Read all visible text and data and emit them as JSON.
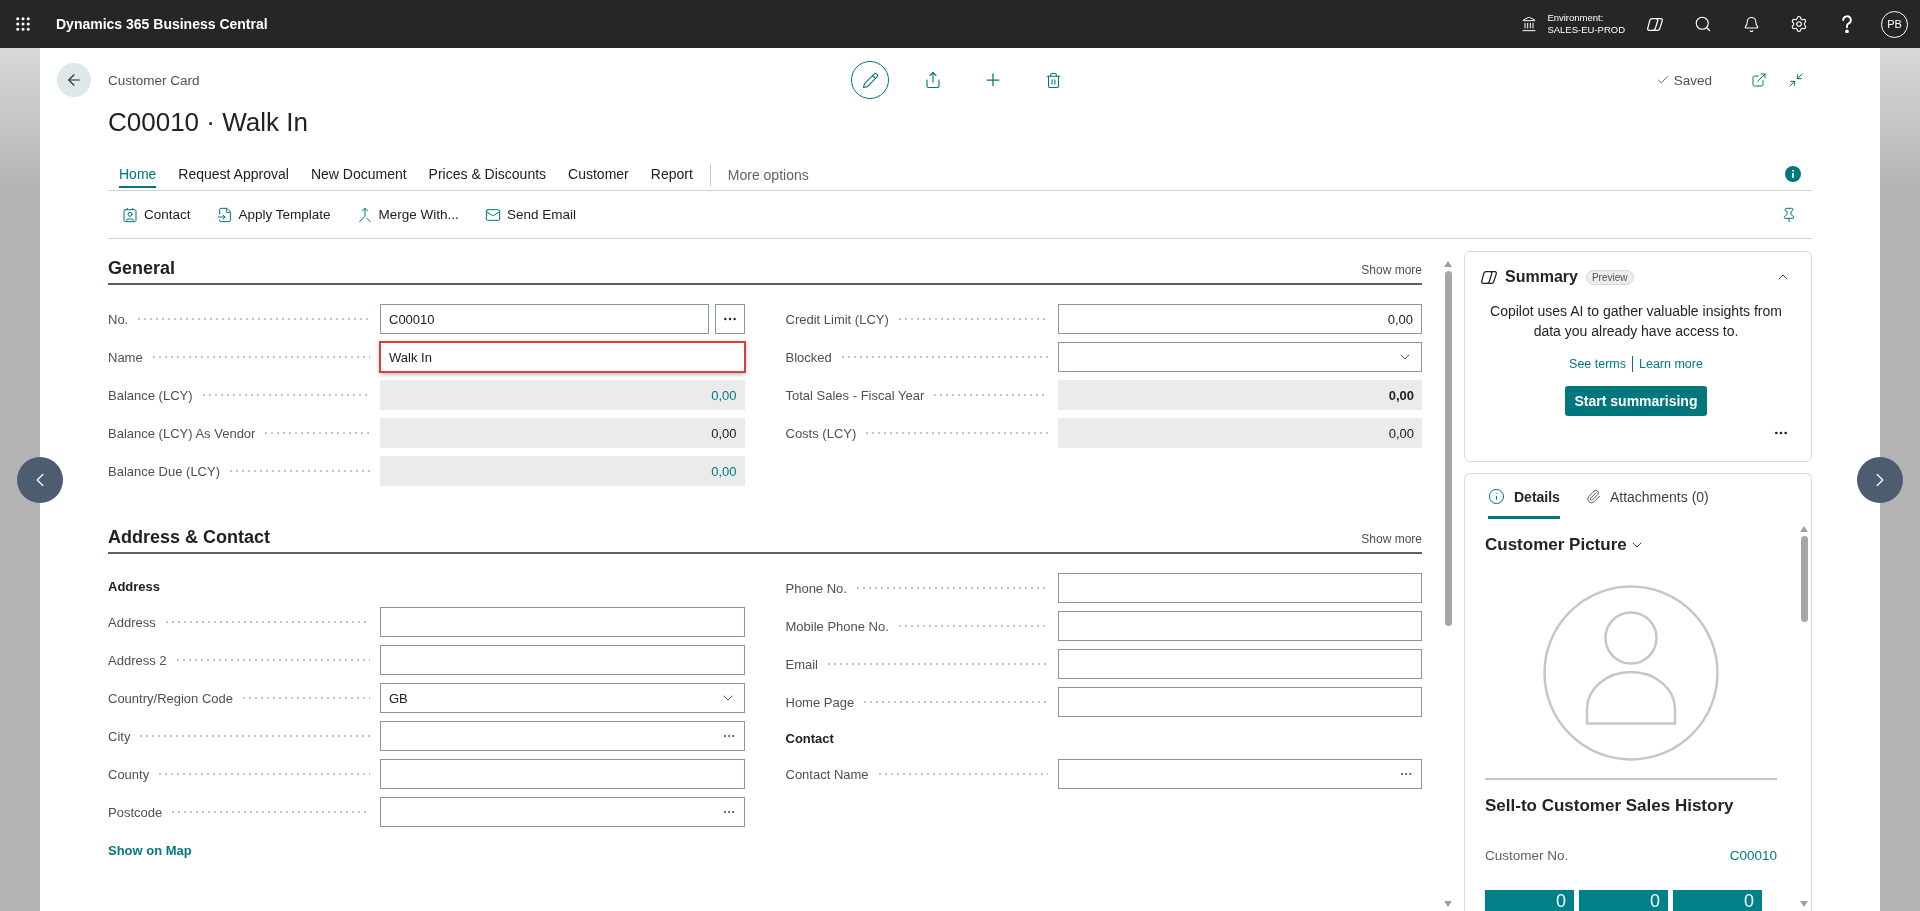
{
  "app_bar": {
    "title": "Dynamics 365 Business Central",
    "environment_label": "Environment:",
    "environment_name": "SALES-EU-PROD",
    "avatar_initials": "PB"
  },
  "header": {
    "breadcrumb": "Customer Card",
    "title": "C00010 · Walk In",
    "save_status": "Saved"
  },
  "action_tabs": [
    {
      "label": "Home",
      "selected": true
    },
    {
      "label": "Request Approval",
      "selected": false
    },
    {
      "label": "New Document",
      "selected": false
    },
    {
      "label": "Prices & Discounts",
      "selected": false
    },
    {
      "label": "Customer",
      "selected": false
    },
    {
      "label": "Report",
      "selected": false
    }
  ],
  "more_options": "More options",
  "actions": [
    "Contact",
    "Apply Template",
    "Merge With...",
    "Send Email"
  ],
  "sections": [
    {
      "title": "General",
      "show_more": "Show more",
      "columns": [
        [
          {
            "kind": "assist",
            "label": "No.",
            "value": "C00010",
            "highlighted": false
          },
          {
            "kind": "text",
            "label": "Name",
            "value": "Walk In",
            "highlighted": true
          },
          {
            "kind": "readonly",
            "label": "Balance (LCY)",
            "value": "0,00",
            "drilldown": true,
            "bold": false
          },
          {
            "kind": "readonly",
            "label": "Balance (LCY) As Vendor",
            "value": "0,00",
            "drilldown": false,
            "bold": false
          },
          {
            "kind": "readonly",
            "label": "Balance Due (LCY)",
            "value": "0,00",
            "drilldown": true,
            "bold": false
          }
        ],
        [
          {
            "kind": "number",
            "label": "Credit Limit (LCY)",
            "value": "0,00",
            "highlighted": false
          },
          {
            "kind": "dropdown",
            "label": "Blocked",
            "highlighted": false
          },
          {
            "kind": "readonly",
            "label": "Total Sales - Fiscal Year",
            "value": "0,00",
            "drilldown": false,
            "bold": true
          },
          {
            "kind": "readonly",
            "label": "Costs (LCY)",
            "value": "0,00",
            "drilldown": false,
            "bold": false
          }
        ]
      ]
    },
    {
      "title": "Address & Contact",
      "show_more": "Show more",
      "columns": [
        [
          {
            "kind": "heading",
            "text": "Address"
          },
          {
            "kind": "text",
            "label": "Address",
            "highlighted": false
          },
          {
            "kind": "text",
            "label": "Address 2",
            "highlighted": false
          },
          {
            "kind": "dropdown",
            "label": "Country/Region Code",
            "value": "GB",
            "highlighted": false
          },
          {
            "kind": "lookup",
            "label": "City",
            "highlighted": false
          },
          {
            "kind": "text",
            "label": "County",
            "highlighted": false
          },
          {
            "kind": "lookup",
            "label": "Postcode",
            "highlighted": false
          },
          {
            "kind": "link",
            "text": "Show on Map"
          }
        ],
        [
          {
            "kind": "text",
            "label": "Phone No.",
            "highlighted": false
          },
          {
            "kind": "text",
            "label": "Mobile Phone No.",
            "highlighted": false
          },
          {
            "kind": "text",
            "label": "Email",
            "highlighted": false
          },
          {
            "kind": "text",
            "label": "Home Page",
            "highlighted": false
          },
          {
            "kind": "heading",
            "text": "Contact"
          },
          {
            "kind": "lookup",
            "label": "Contact Name",
            "highlighted": false
          }
        ]
      ]
    }
  ],
  "summary": {
    "title": "Summary",
    "badge": "Preview",
    "expanded": true,
    "text": "Copilot uses AI to gather valuable insights from data you already have access to.",
    "links": [
      "See terms",
      "Learn more"
    ],
    "button": "Start summarising"
  },
  "factbox": {
    "tabs": [
      {
        "label": "Details",
        "selected": true
      },
      {
        "label": "Attachments (0)",
        "selected": false
      }
    ],
    "picture_title": "Customer Picture",
    "history_title": "Sell-to Customer Sales History",
    "customer_no_label": "Customer No.",
    "customer_no": "C00010",
    "tiles": [
      "0",
      "0",
      "0"
    ]
  }
}
